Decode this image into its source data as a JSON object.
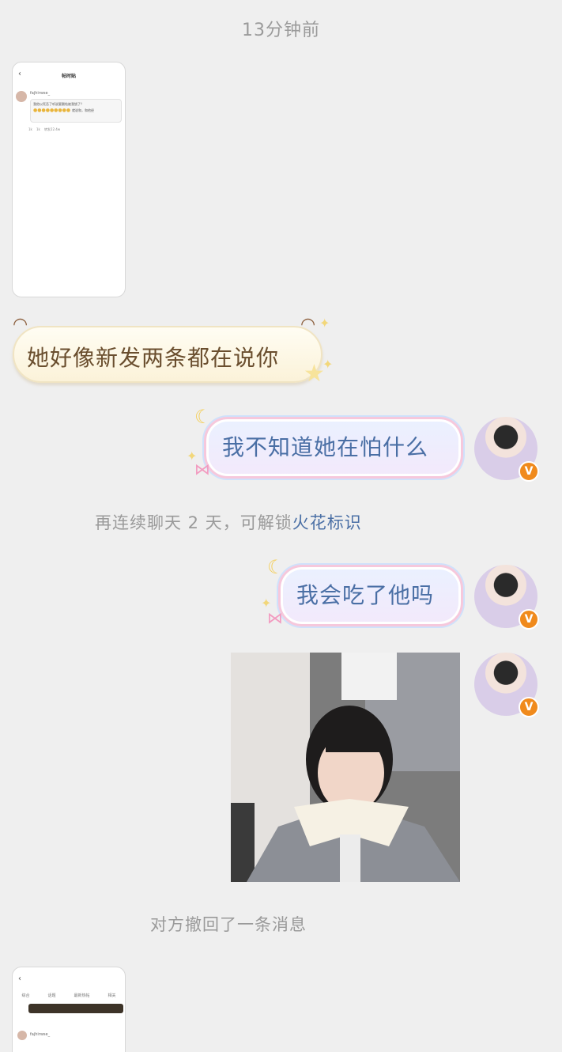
{
  "timestamp": "13分钟前",
  "thumb1": {
    "title": "帖时贴",
    "username": "fajhirwse_",
    "quote_text": "我他以死吾了听说要删帖被我锁了？",
    "quote_text2": "就说和，和他经",
    "actions": [
      "1k",
      "1k",
      "转发22.4w"
    ]
  },
  "incoming_message": "她好像新发两条都在说你",
  "outgoing_message_1": "我不知道她在怕什么",
  "system_notice": {
    "prefix": "再连续聊天 2 天，可解锁",
    "highlight": "火花标识"
  },
  "outgoing_message_2": "我会吃了他吗",
  "recall_notice": "对方撤回了一条消息",
  "thumb2": {
    "tabs": [
      "综合",
      "话题",
      "最新热帖",
      "相关"
    ],
    "username": "fajhirwse_"
  },
  "avatar_badge": "V",
  "colors": {
    "background": "#efefef",
    "incoming_text": "#6a4e2e",
    "outgoing_text": "#4a6fa5",
    "badge": "#f08a1c",
    "link": "#4a6fa5"
  }
}
